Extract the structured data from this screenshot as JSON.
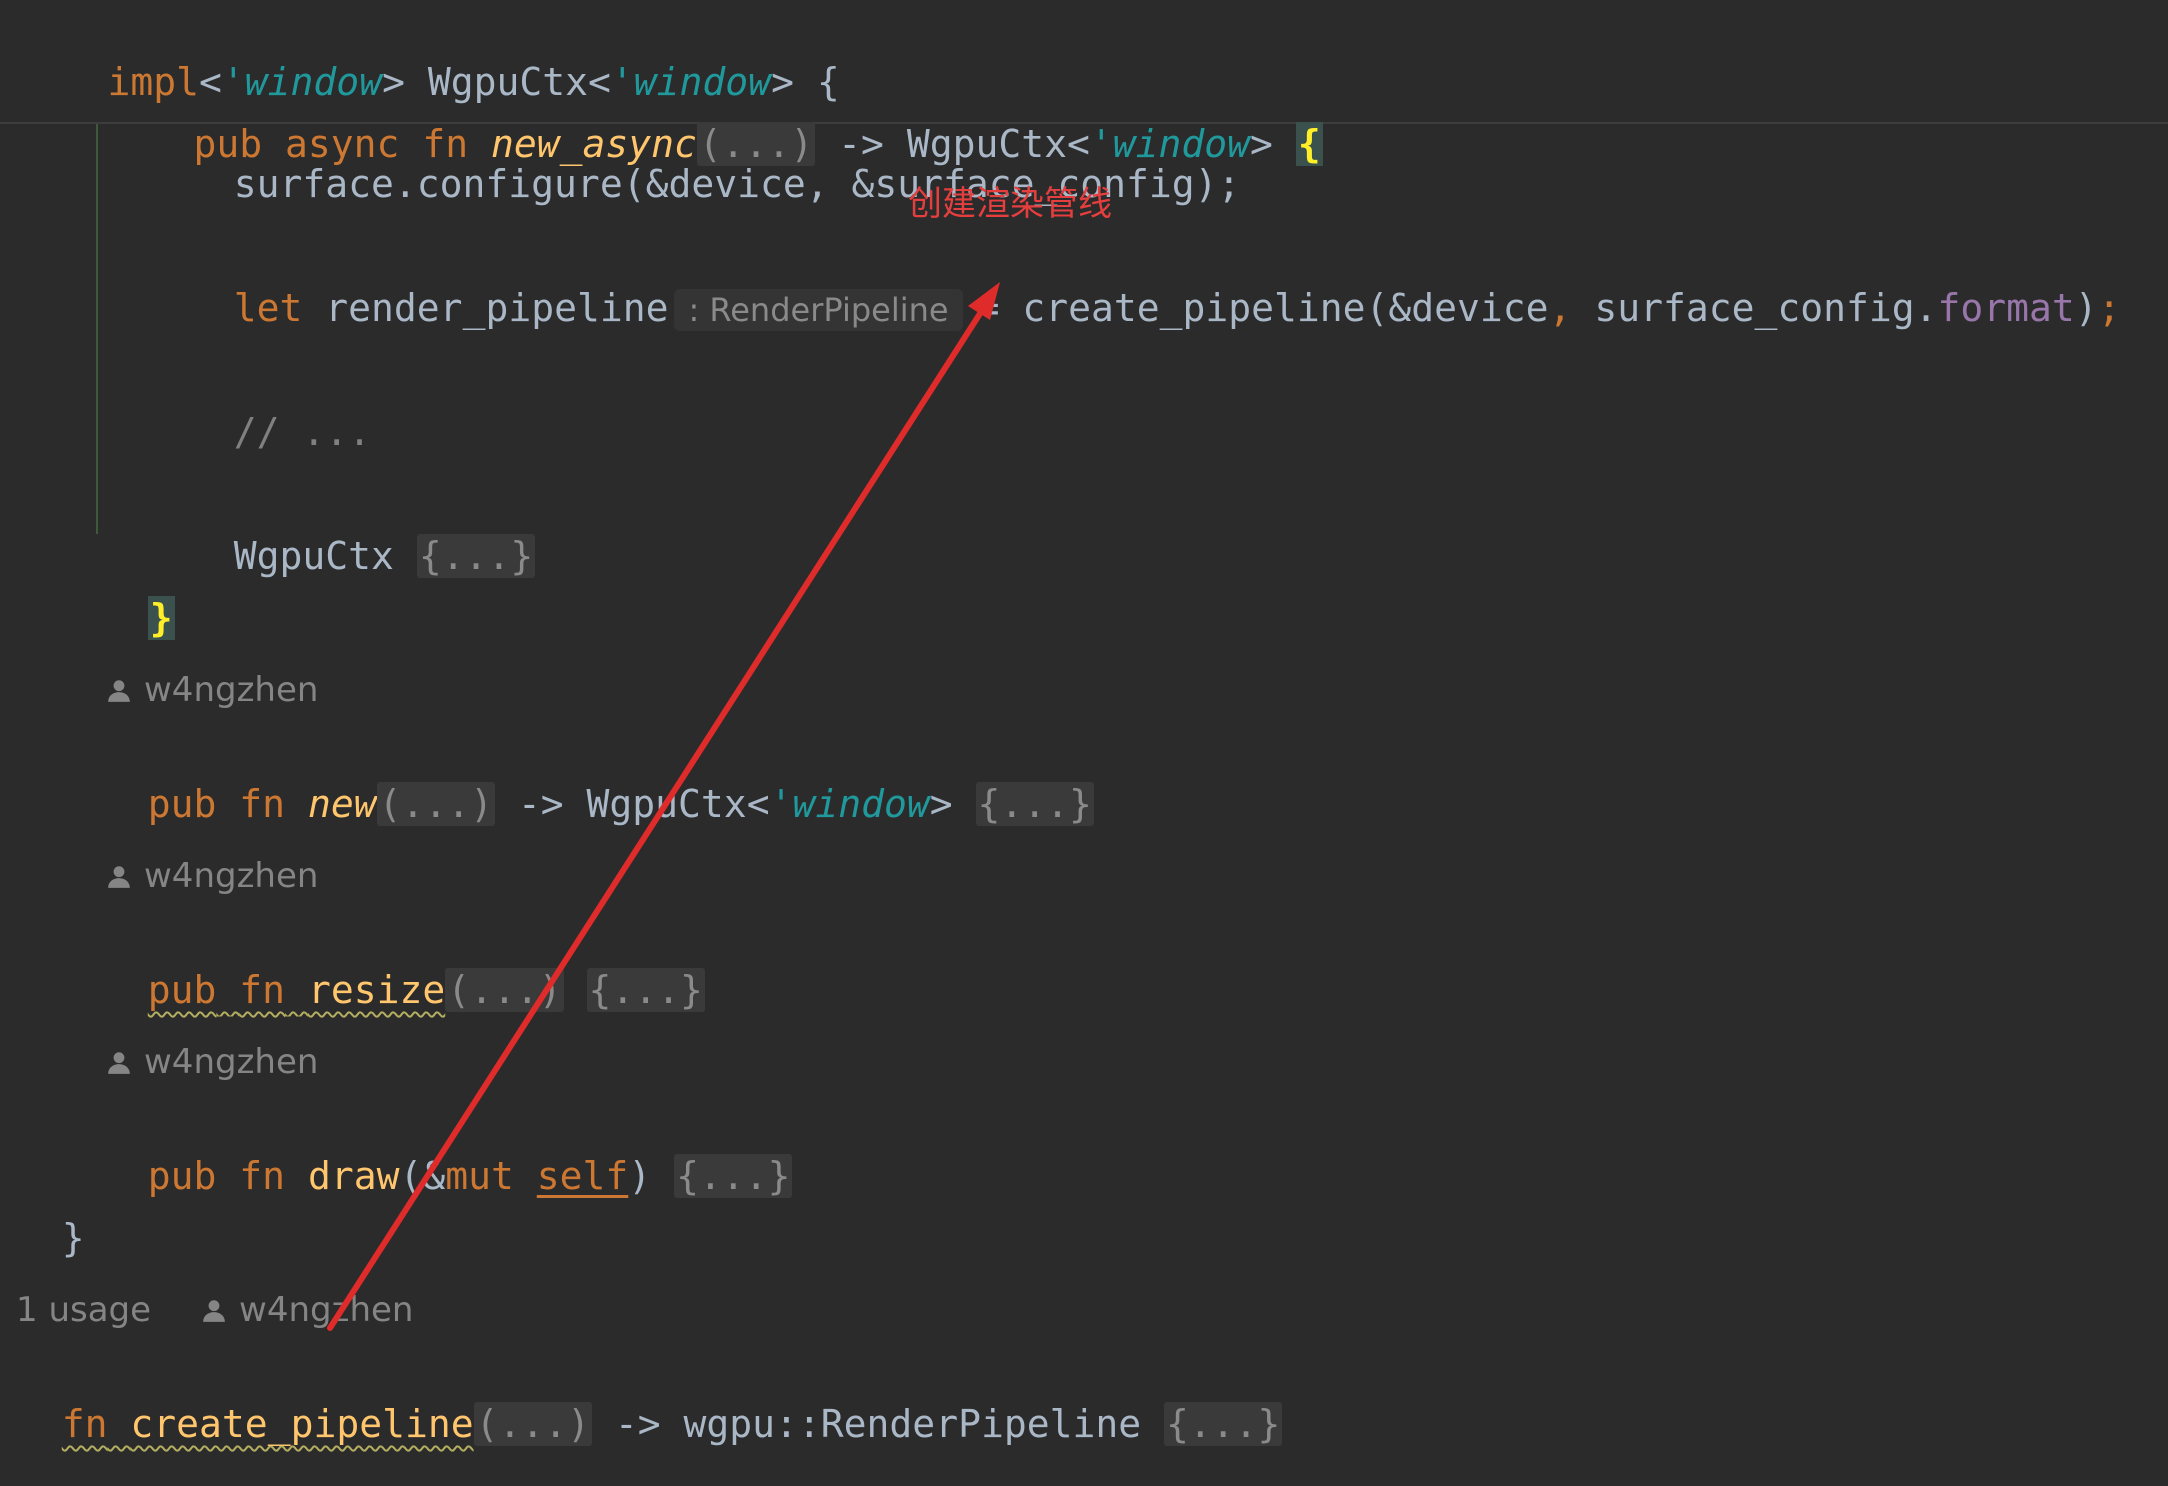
{
  "code": {
    "impl_kw": "impl",
    "lt_open": "<",
    "lifetime": "'window",
    "lt_close": ">",
    "type_name": "WgpuCtx",
    "open_brace": "{",
    "pub": "pub",
    "async": "async",
    "fn": "fn",
    "fn_new_async": "new_async",
    "folded_params": "(...)",
    "arrow": "->",
    "configure_partial": "surface.configure(&device, &surface_config);",
    "let": "let",
    "var_render_pipeline": "render_pipeline",
    "type_hint": ": RenderPipeline",
    "eq": "=",
    "call_create_pipeline": "create_pipeline(&device",
    "comma": ",",
    "surface_config_dot": "surface_config.",
    "field_format": "format",
    "close_call": ")",
    "semicolon": ";",
    "comment": "// ...",
    "wgpuctx_literal": "WgpuCtx",
    "folded_body": "{...}",
    "close_brace": "}",
    "fn_new": "new",
    "fn_resize": "resize",
    "fn_draw": "draw",
    "draw_open": "(&",
    "mut": "mut",
    "self": "self",
    "draw_close": ")",
    "fn_create_pipeline": "create_pipeline",
    "return_type": "wgpu::RenderPipeline"
  },
  "authors": {
    "new": "w4ngzhen",
    "resize": "w4ngzhen",
    "draw": "w4ngzhen",
    "create_pipeline": "w4ngzhen"
  },
  "usage_label": "1 usage",
  "annotation_text": "创建渲染管线",
  "icons": {
    "author": "person-icon"
  },
  "colors": {
    "annotation": "#e53e3e",
    "background": "#2b2b2b"
  }
}
